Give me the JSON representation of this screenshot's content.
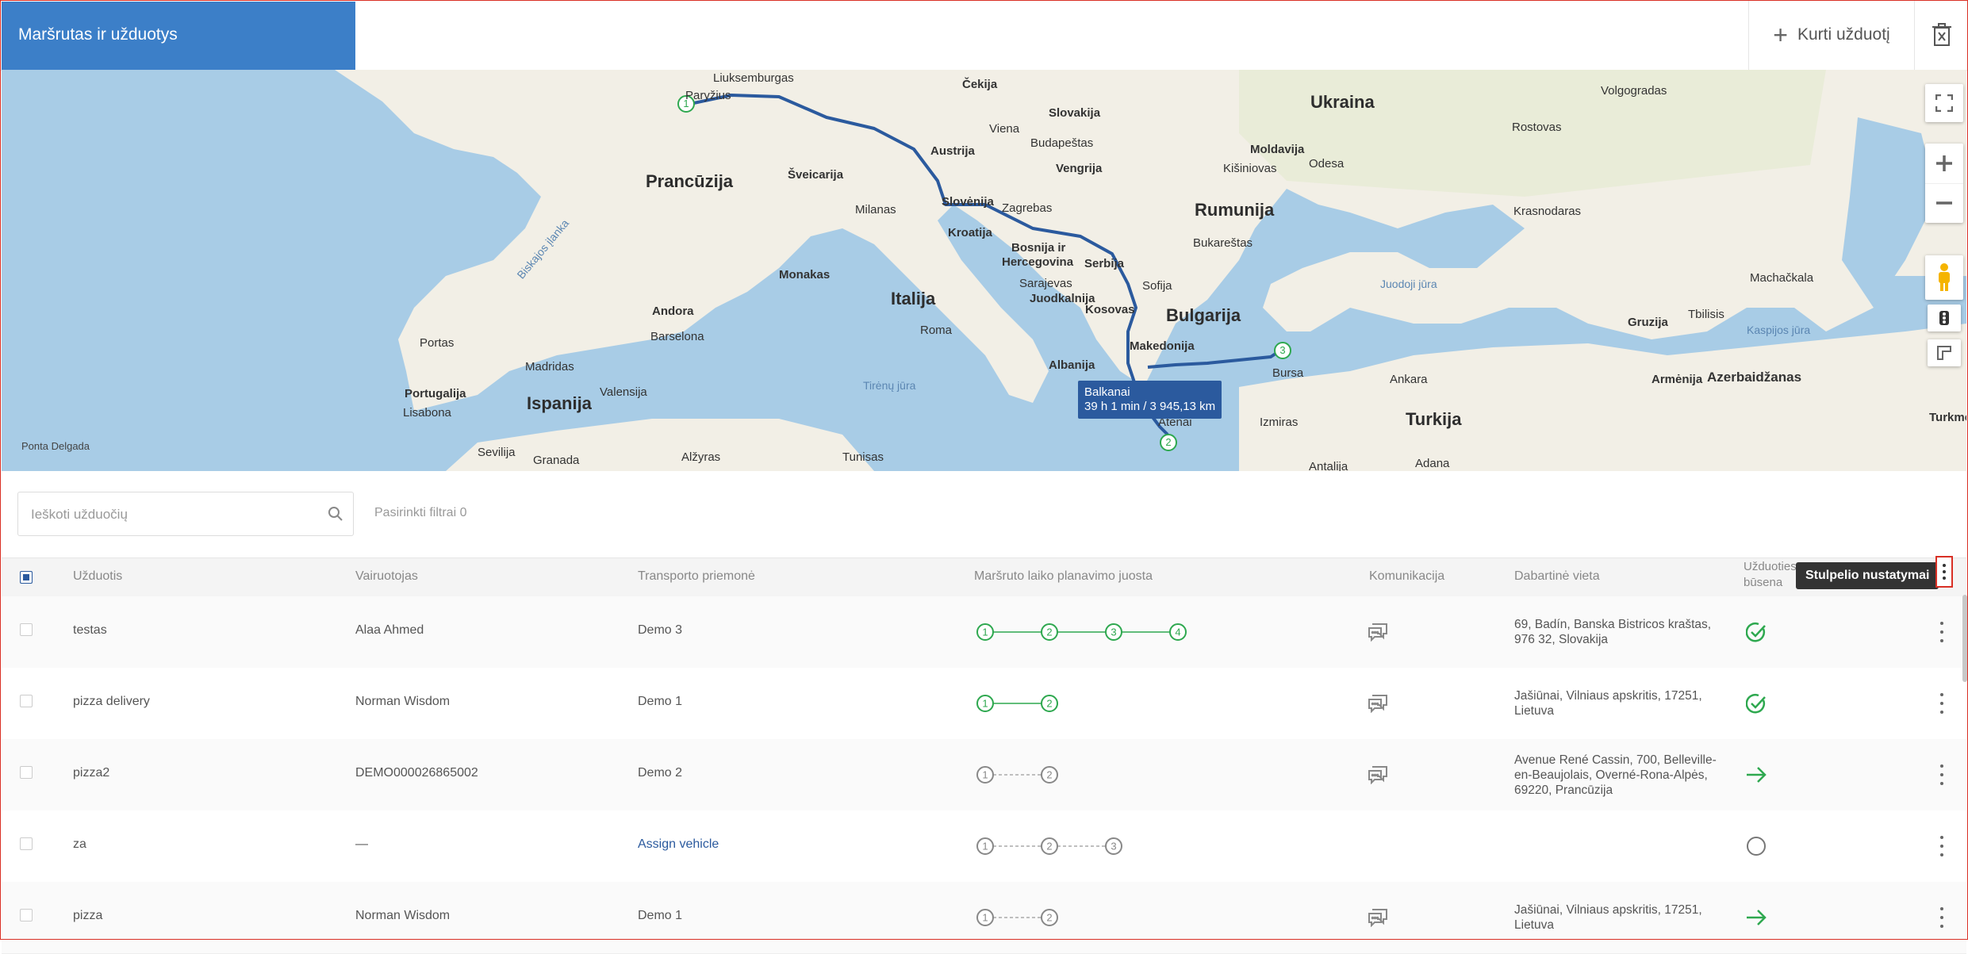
{
  "header": {
    "title": "Maršrutas ir užduotys",
    "create_task_label": "Kurti užduotį",
    "create_icon": "plus-icon",
    "delete_icon": "trash-icon"
  },
  "map": {
    "route_tooltip": {
      "title": "Balkanai",
      "detail": "39 h 1 min / 3 945,13 km"
    },
    "waypoints": [
      "1",
      "2",
      "3"
    ],
    "labels": {
      "ukraina": "Ukraina",
      "pranciuzija": "Prancūzija",
      "rumunija": "Rumunija",
      "italija": "Italija",
      "ispanija": "Ispanija",
      "bulgarija": "Bulgarija",
      "turkija": "Turkija",
      "portugalija": "Portugalija",
      "liuksemburgas": "Liuksemburgas",
      "cekija": "Čekija",
      "slovakija": "Slovakija",
      "austrija": "Austrija",
      "budapestas": "Budapeštas",
      "vengrija": "Vengrija",
      "sveicarija": "Šveicarija",
      "milanas": "Milanas",
      "zagrebas": "Zagrebas",
      "kroatija": "Kroatija",
      "monakas": "Monakas",
      "bosnija": "Bosnija ir",
      "hercegovina": "Hercegovina",
      "sarajevas": "Sarajevas",
      "serbija": "Serbija",
      "juodkalnija": "Juodkalnija",
      "sofija": "Sofija",
      "kosovas": "Kosovas",
      "roma": "Roma",
      "andora": "Andora",
      "barselona": "Barselona",
      "madridas": "Madridas",
      "valensija": "Valensija",
      "lisabona": "Lisabona",
      "portas": "Portas",
      "sevilija": "Sevilija",
      "granada": "Granada",
      "alziras": "Alžyras",
      "tunisas": "Tunisas",
      "albanija": "Albanija",
      "atenai": "Atėnai",
      "bursa": "Bursa",
      "ankara": "Ankara",
      "izmiras": "Izmiras",
      "antalija": "Antalija",
      "adana": "Adana",
      "bukarestas": "Bukareštas",
      "moldavija": "Moldavija",
      "kisiniovas": "Kišiniovas",
      "odesa": "Odesa",
      "volgogradas": "Volgogradas",
      "rostovas": "Rostovas",
      "krasnodaras": "Krasnodaras",
      "gruzija": "Gruzija",
      "tbilisis": "Tbilisis",
      "armenija": "Armėnija",
      "azerbaidzanas": "Azerbaidžanas",
      "juodoji_jura": "Juodoji jūra",
      "kaspijos_jura": "Kaspijos jūra",
      "biskajos_ilanka": "Biskajos įlanka",
      "tireno_jura": "Tirėnų jūra",
      "ponta_delgada": "Ponta Delgada",
      "paryzius": "Paryžius",
      "viena": "Viena",
      "slovenija": "Slovėnija",
      "makedonija": "Makedonija",
      "turkmenija": "Turkmėn",
      "machackala": "Machačkala"
    }
  },
  "filter": {
    "search_placeholder": "Ieškoti užduočių",
    "selected_filters": "Pasirinkti filtrai 0"
  },
  "table": {
    "columns": {
      "task": "Užduotis",
      "driver": "Vairuotojas",
      "vehicle": "Transporto priemonė",
      "timeline": "Maršruto laiko planavimo juosta",
      "communication": "Komunikacija",
      "location": "Dabartinė vieta",
      "status_line1": "Užduoties",
      "status_line2": "būsena"
    },
    "column_settings_tooltip": "Stulpelio nustatymai",
    "rows": [
      {
        "task": "testas",
        "driver": "Alaa Ahmed",
        "vehicle": "Demo 3",
        "stops": [
          "1",
          "2",
          "3",
          "4"
        ],
        "done": true,
        "has_chat": true,
        "location_line1": "69, Badín, Banska Bistricos kraštas,",
        "location_line2": "976 32, Slovakija",
        "location_line3": "",
        "status_icon": "check-circle-icon"
      },
      {
        "task": "pizza delivery",
        "driver": "Norman Wisdom",
        "vehicle": "Demo 1",
        "stops": [
          "1",
          "2"
        ],
        "done": true,
        "has_chat": true,
        "location_line1": "Jašiūnai, Vilniaus apskritis, 17251,",
        "location_line2": "Lietuva",
        "location_line3": "",
        "status_icon": "arrow-right-icon-complete"
      },
      {
        "task": "pizza2",
        "driver": "DEMO000026865002",
        "vehicle": "Demo 2",
        "stops": [
          "1",
          "2"
        ],
        "done": false,
        "has_chat": true,
        "location_line1": "Avenue René Cassin, 700, Belleville-",
        "location_line2": "en-Beaujolais, Overné-Rona-Alpės,",
        "location_line3": "69220, Prancūzija",
        "status_icon": "arrow-right-icon"
      },
      {
        "task": "za",
        "driver": "—",
        "vehicle": "Assign vehicle",
        "stops": [
          "1",
          "2",
          "3"
        ],
        "done": false,
        "has_chat": false,
        "location_line1": "",
        "location_line2": "",
        "location_line3": "",
        "status_icon": "empty-circle-icon"
      },
      {
        "task": "pizza",
        "driver": "Norman Wisdom",
        "vehicle": "Demo 1",
        "stops": [
          "1",
          "2"
        ],
        "done": false,
        "has_chat": true,
        "location_line1": "Jašiūnai, Vilniaus apskritis, 17251,",
        "location_line2": "Lietuva",
        "location_line3": "",
        "status_icon": "arrow-right-icon"
      }
    ]
  },
  "colors": {
    "brand": "#3c7fc8",
    "route": "#2b5a9e",
    "success": "#2ea84f",
    "alert": "#d93025"
  }
}
